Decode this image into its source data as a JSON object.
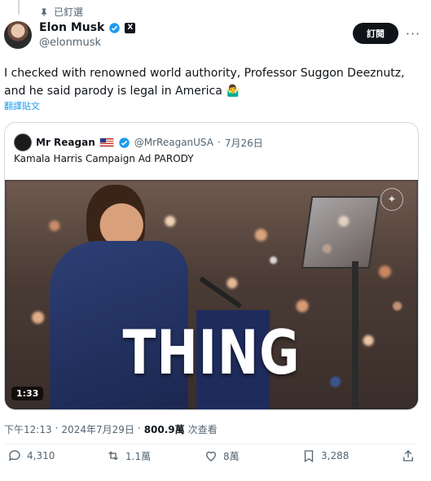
{
  "pinned_label": "已釘選",
  "author": {
    "name": "Elon Musk",
    "handle": "@elonmusk",
    "x_badge": "X"
  },
  "subscribe_label": "訂閱",
  "tweet": {
    "text": "I checked with renowned world authority, Professor Suggon Deeznutz, and he said parody is legal in America 🤷‍♂️",
    "translate_label": "翻譯貼文"
  },
  "quote": {
    "name": "Mr Reagan",
    "handle": "@MrReaganUSA",
    "separator": "·",
    "date": "7月26日",
    "text": "Kamala Harris Campaign Ad PARODY",
    "video_caption": "THING",
    "duration": "1:33"
  },
  "meta": {
    "time": "下午12:13",
    "separator": "·",
    "date": "2024年7月29日",
    "views": "800.9萬",
    "views_label": "次查看"
  },
  "actions": {
    "replies": "4,310",
    "reposts": "1.1萬",
    "likes": "8萬",
    "bookmarks": "3,288"
  },
  "colors": {
    "accent": "#1d9bf0",
    "text": "#0f1419",
    "muted": "#536471",
    "border": "#cfd9de"
  },
  "icons": [
    "pin-icon",
    "verified-icon",
    "x-badge-icon",
    "more-icon",
    "reply-icon",
    "repost-icon",
    "like-icon",
    "bookmark-icon",
    "share-icon",
    "flag-icon"
  ]
}
